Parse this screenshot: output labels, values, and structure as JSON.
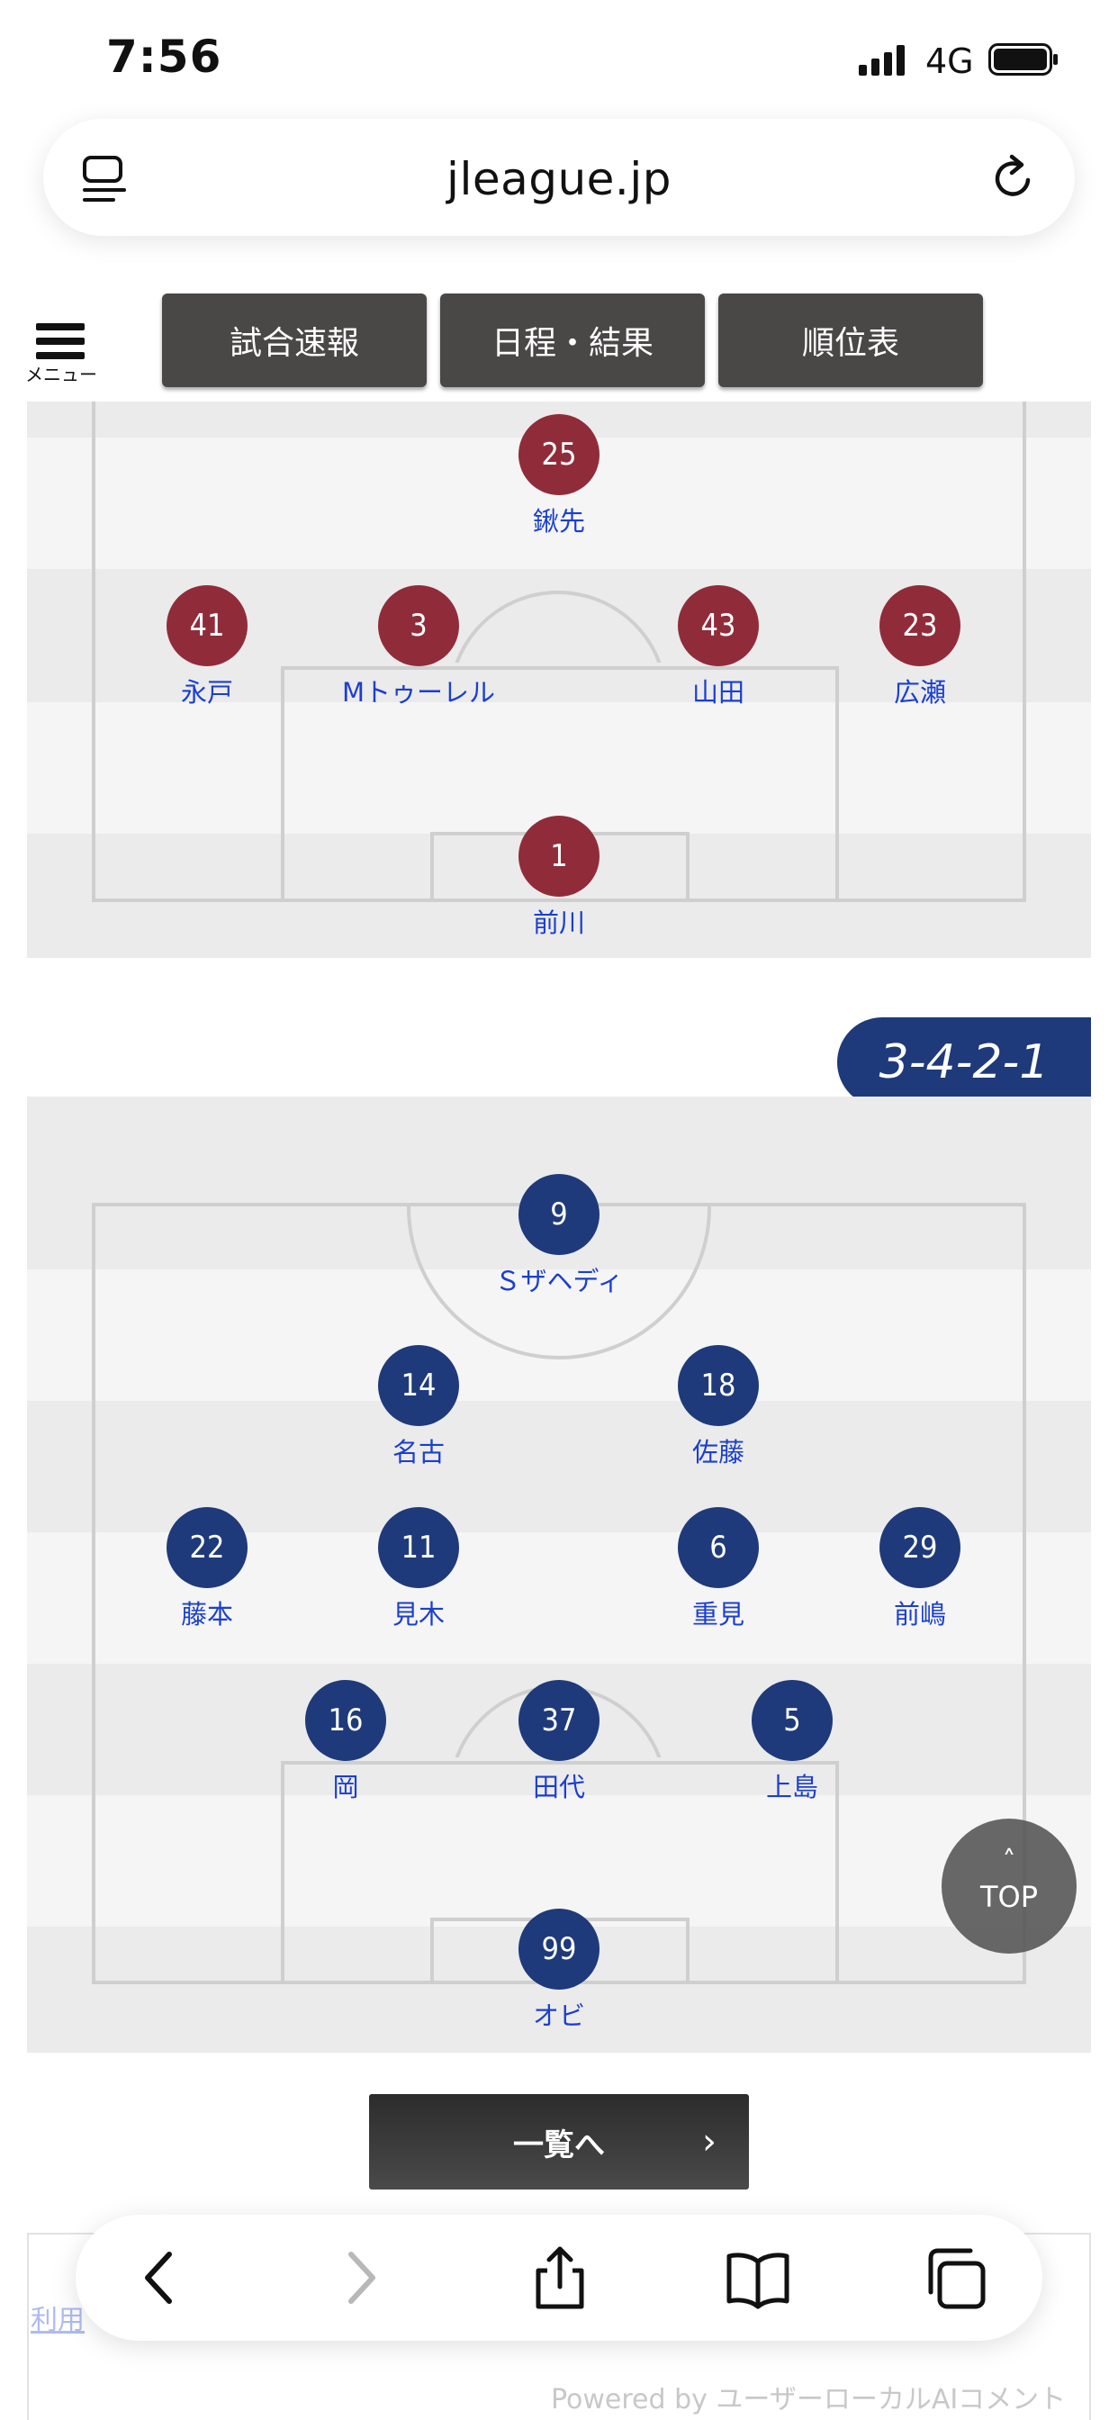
{
  "status_bar": {
    "time": "7:56",
    "network": "4G"
  },
  "browser": {
    "url": "jleague.jp"
  },
  "site_nav": {
    "menu_label": "メニュー",
    "buttons": [
      "試合速報",
      "日程・結果",
      "順位表"
    ]
  },
  "home_team": {
    "color": "#902c3a",
    "players": [
      {
        "number": "25",
        "name": "鍬先"
      },
      {
        "number": "41",
        "name": "永戸"
      },
      {
        "number": "3",
        "name": "Mトゥーレル"
      },
      {
        "number": "43",
        "name": "山田"
      },
      {
        "number": "23",
        "name": "広瀬"
      },
      {
        "number": "1",
        "name": "前川"
      }
    ]
  },
  "away_team": {
    "color": "#1e3a7b",
    "formation": "3-4-2-1",
    "players": [
      {
        "number": "9",
        "name": "Ｓザヘディ"
      },
      {
        "number": "14",
        "name": "名古"
      },
      {
        "number": "18",
        "name": "佐藤"
      },
      {
        "number": "22",
        "name": "藤本"
      },
      {
        "number": "11",
        "name": "見木"
      },
      {
        "number": "6",
        "name": "重見"
      },
      {
        "number": "29",
        "name": "前嶋"
      },
      {
        "number": "16",
        "name": "岡"
      },
      {
        "number": "37",
        "name": "田代"
      },
      {
        "number": "5",
        "name": "上島"
      },
      {
        "number": "99",
        "name": "オビ"
      }
    ]
  },
  "list_button": {
    "label": "一覧へ",
    "arrow": "›"
  },
  "top_button": {
    "caret": "˄",
    "label": "TOP"
  },
  "footer": {
    "terms_link": "利用",
    "powered_by": "Powered by ユーザーローカルAIコメント"
  }
}
